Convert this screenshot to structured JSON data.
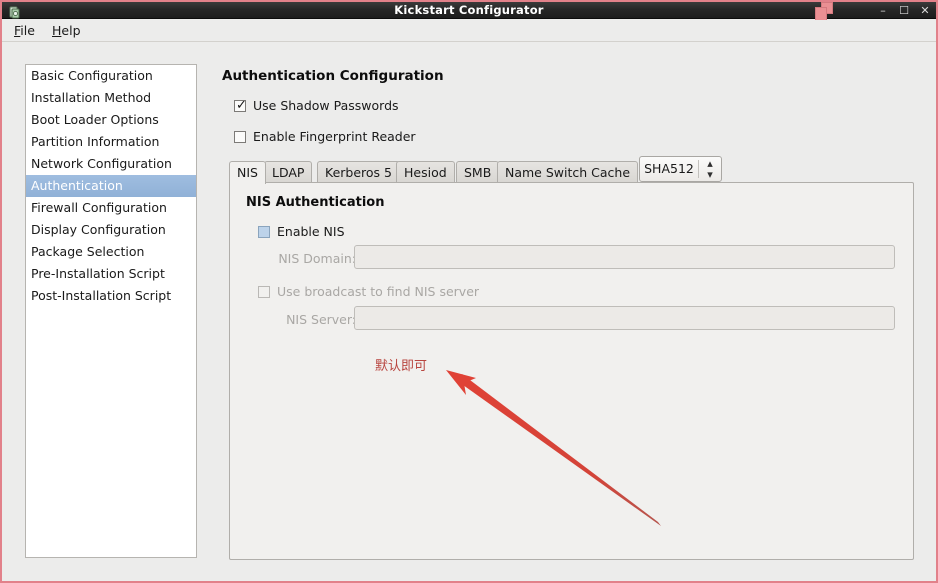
{
  "window": {
    "title": "Kickstart Configurator",
    "app_icon": "app-icon",
    "overlay_icon": "windows-overlay-icon",
    "border_color": "#e2818a",
    "controls": {
      "minimize": "–",
      "maximize": "☐",
      "close": "✕"
    }
  },
  "menubar": {
    "items": [
      {
        "label": "File",
        "mnemonic": "F",
        "rest": "ile"
      },
      {
        "label": "Help",
        "mnemonic": "H",
        "rest": "elp"
      }
    ]
  },
  "sidebar": {
    "selected_index": 5,
    "selection_color": "#97b6dd",
    "items": [
      {
        "label": "Basic Configuration"
      },
      {
        "label": "Installation Method"
      },
      {
        "label": "Boot Loader Options"
      },
      {
        "label": "Partition Information"
      },
      {
        "label": "Network Configuration"
      },
      {
        "label": "Authentication"
      },
      {
        "label": "Firewall Configuration"
      },
      {
        "label": "Display Configuration"
      },
      {
        "label": "Package Selection"
      },
      {
        "label": "Pre-Installation Script"
      },
      {
        "label": "Post-Installation Script"
      }
    ]
  },
  "main": {
    "title": "Authentication Configuration",
    "shadow_passwords": {
      "label": "Use Shadow Passwords",
      "checked": true,
      "check_glyph": "✓"
    },
    "hash_algorithm": {
      "value": "SHA512",
      "up_glyph": "▴",
      "down_glyph": "▾"
    },
    "fingerprint_reader": {
      "label": "Enable Fingerprint Reader",
      "checked": false
    },
    "tabs": [
      {
        "label": "NIS",
        "active": true
      },
      {
        "label": "LDAP",
        "active": false
      },
      {
        "label": "Kerberos 5",
        "active": false
      },
      {
        "label": "Hesiod",
        "active": false
      },
      {
        "label": "SMB",
        "active": false
      },
      {
        "label": "Name Switch Cache",
        "active": false
      }
    ],
    "nis_panel": {
      "heading": "NIS Authentication",
      "enable_nis": {
        "label": "Enable NIS",
        "checked": false
      },
      "domain": {
        "label": "NIS Domain:",
        "value": "",
        "placeholder": "",
        "disabled": true
      },
      "broadcast": {
        "label": "Use broadcast to find NIS server",
        "checked": false,
        "disabled": true
      },
      "server": {
        "label": "NIS Server:",
        "value": "",
        "placeholder": "",
        "disabled": true
      }
    }
  },
  "annotation": {
    "text": "默认即可",
    "color": "#cf4338"
  }
}
